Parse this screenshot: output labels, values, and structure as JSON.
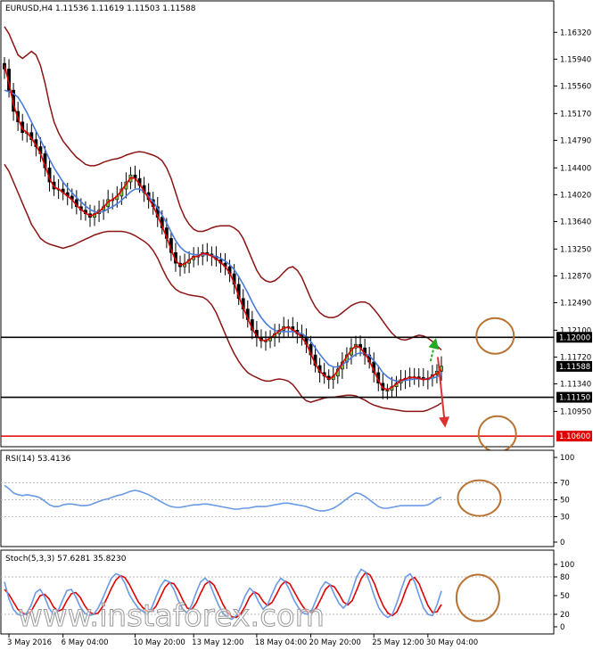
{
  "chart_data": {
    "type": "line",
    "symbol_header": "EURUSD,H4  1.11536 1.11619 1.11503 1.11588",
    "price_axis": {
      "ylim": [
        1.1045,
        1.165
      ],
      "ticks": [
        "1.16320",
        "1.15940",
        "1.15560",
        "1.15170",
        "1.14790",
        "1.14400",
        "1.14020",
        "1.13640",
        "1.13250",
        "1.12870",
        "1.12490",
        "1.12100",
        "1.11720",
        "1.11340",
        "1.10950"
      ]
    },
    "x_labels": [
      {
        "i": 1,
        "label": "3 May 2016"
      },
      {
        "i": 13,
        "label": "6 May 04:00"
      },
      {
        "i": 29,
        "label": "10 May 20:00"
      },
      {
        "i": 42,
        "label": "13 May 12:00"
      },
      {
        "i": 56,
        "label": "18 May 04:00"
      },
      {
        "i": 68,
        "label": "20 May 20:00"
      },
      {
        "i": 82,
        "label": "25 May 12:00"
      },
      {
        "i": 94,
        "label": "30 May 04:00"
      }
    ],
    "series": [
      {
        "kind": "close",
        "color": "#1a1a1a",
        "values": [
          1.158,
          1.155,
          1.152,
          1.1505,
          1.149,
          1.149,
          1.148,
          1.147,
          1.146,
          1.144,
          1.142,
          1.141,
          1.141,
          1.1405,
          1.14,
          1.1395,
          1.1385,
          1.138,
          1.1375,
          1.137,
          1.1375,
          1.138,
          1.1385,
          1.1395,
          1.1395,
          1.14,
          1.141,
          1.142,
          1.143,
          1.1425,
          1.1415,
          1.1405,
          1.1395,
          1.1385,
          1.137,
          1.1355,
          1.134,
          1.132,
          1.1305,
          1.13,
          1.1305,
          1.131,
          1.1315,
          1.1315,
          1.132,
          1.1318,
          1.1315,
          1.131,
          1.1305,
          1.13,
          1.129,
          1.1275,
          1.1255,
          1.124,
          1.1225,
          1.121,
          1.12,
          1.1195,
          1.1195,
          1.12,
          1.1205,
          1.121,
          1.1215,
          1.1215,
          1.121,
          1.1205,
          1.12,
          1.119,
          1.1175,
          1.116,
          1.115,
          1.1145,
          1.114,
          1.1145,
          1.1155,
          1.1165,
          1.1175,
          1.1185,
          1.119,
          1.1185,
          1.1175,
          1.1165,
          1.115,
          1.1135,
          1.1125,
          1.1125,
          1.113,
          1.1135,
          1.114,
          1.1142,
          1.1144,
          1.1144,
          1.1143,
          1.114,
          1.1142,
          1.1147,
          1.1152,
          1.1159
        ]
      },
      {
        "kind": "ma_fast",
        "color": "#e00000",
        "values": [
          1.1585,
          1.156,
          1.153,
          1.151,
          1.1495,
          1.149,
          1.1482,
          1.1472,
          1.146,
          1.1443,
          1.1425,
          1.1413,
          1.141,
          1.1405,
          1.14,
          1.1395,
          1.1387,
          1.1381,
          1.1376,
          1.1372,
          1.1374,
          1.1378,
          1.1384,
          1.1392,
          1.1395,
          1.14,
          1.1408,
          1.1417,
          1.1426,
          1.1425,
          1.1417,
          1.1407,
          1.1397,
          1.1386,
          1.1372,
          1.1357,
          1.1342,
          1.1324,
          1.1309,
          1.1302,
          1.1304,
          1.1309,
          1.1314,
          1.1315,
          1.1319,
          1.1318,
          1.1315,
          1.1311,
          1.1306,
          1.13,
          1.1291,
          1.1277,
          1.1258,
          1.1242,
          1.1227,
          1.1212,
          1.1202,
          1.1196,
          1.1195,
          1.1199,
          1.1204,
          1.1209,
          1.1213,
          1.1214,
          1.1211,
          1.1206,
          1.12,
          1.1191,
          1.1177,
          1.1162,
          1.1152,
          1.1146,
          1.1141,
          1.1144,
          1.1153,
          1.1163,
          1.1173,
          1.1182,
          1.1188,
          1.1185,
          1.1177,
          1.1167,
          1.1153,
          1.1139,
          1.1128,
          1.1126,
          1.1129,
          1.1134,
          1.1139,
          1.1141,
          1.1143,
          1.1143,
          1.1142,
          1.114,
          1.1141,
          1.1145,
          1.1149,
          1.1154
        ]
      },
      {
        "kind": "ma_slow",
        "color": "#4a7bdb",
        "values": [
          1.155,
          1.1548,
          1.1545,
          1.154,
          1.153,
          1.1518,
          1.1505,
          1.1492,
          1.148,
          1.1466,
          1.1452,
          1.144,
          1.143,
          1.142,
          1.1412,
          1.1405,
          1.1398,
          1.1392,
          1.1386,
          1.1381,
          1.1378,
          1.1377,
          1.1378,
          1.1382,
          1.1385,
          1.1389,
          1.1394,
          1.14,
          1.1406,
          1.141,
          1.141,
          1.1406,
          1.14,
          1.1392,
          1.1383,
          1.1373,
          1.1362,
          1.1349,
          1.1337,
          1.1328,
          1.1322,
          1.1319,
          1.1317,
          1.1317,
          1.1317,
          1.1317,
          1.1316,
          1.1314,
          1.1312,
          1.1308,
          1.1303,
          1.1296,
          1.1286,
          1.1275,
          1.1263,
          1.125,
          1.1238,
          1.1228,
          1.122,
          1.1214,
          1.121,
          1.1208,
          1.1208,
          1.1208,
          1.1208,
          1.1207,
          1.1205,
          1.1201,
          1.1194,
          1.1185,
          1.1176,
          1.1168,
          1.1161,
          1.1158,
          1.1158,
          1.1161,
          1.1166,
          1.1171,
          1.1176,
          1.1178,
          1.1177,
          1.1174,
          1.1167,
          1.1159,
          1.115,
          1.1144,
          1.114,
          1.1138,
          1.1138,
          1.1139,
          1.114,
          1.1141,
          1.1141,
          1.1141,
          1.1141,
          1.1142,
          1.1144,
          1.1147
        ]
      },
      {
        "kind": "bollinger_upper",
        "color": "#8b1414",
        "values": [
          1.164,
          1.163,
          1.1615,
          1.16,
          1.1595,
          1.16,
          1.1605,
          1.16,
          1.1585,
          1.156,
          1.153,
          1.1505,
          1.149,
          1.1478,
          1.147,
          1.1462,
          1.1455,
          1.145,
          1.1445,
          1.1443,
          1.1443,
          1.1445,
          1.1448,
          1.145,
          1.1452,
          1.1453,
          1.1455,
          1.1458,
          1.146,
          1.1462,
          1.1463,
          1.1462,
          1.146,
          1.1458,
          1.1455,
          1.145,
          1.144,
          1.1425,
          1.1405,
          1.1385,
          1.137,
          1.136,
          1.1353,
          1.135,
          1.135,
          1.1352,
          1.1355,
          1.1357,
          1.1358,
          1.1358,
          1.1358,
          1.1355,
          1.135,
          1.134,
          1.1325,
          1.131,
          1.1295,
          1.1285,
          1.128,
          1.1278,
          1.128,
          1.1285,
          1.1292,
          1.1298,
          1.13,
          1.1295,
          1.1285,
          1.127,
          1.1255,
          1.1243,
          1.1235,
          1.123,
          1.1228,
          1.1228,
          1.123,
          1.1235,
          1.124,
          1.1245,
          1.1248,
          1.125,
          1.125,
          1.1247,
          1.124,
          1.1232,
          1.1223,
          1.1214,
          1.1206,
          1.12,
          1.1197,
          1.1196,
          1.1198,
          1.1201,
          1.1203,
          1.1202,
          1.1199,
          1.1194,
          1.1188,
          1.1182
        ]
      },
      {
        "kind": "bollinger_lower",
        "color": "#8b1414",
        "values": [
          1.1445,
          1.1435,
          1.142,
          1.1405,
          1.139,
          1.1375,
          1.136,
          1.135,
          1.134,
          1.1335,
          1.1332,
          1.133,
          1.1328,
          1.1326,
          1.1328,
          1.133,
          1.1333,
          1.1336,
          1.1339,
          1.1342,
          1.1345,
          1.1347,
          1.1349,
          1.135,
          1.135,
          1.135,
          1.135,
          1.1349,
          1.1347,
          1.1344,
          1.134,
          1.1336,
          1.1331,
          1.1323,
          1.1312,
          1.1298,
          1.1285,
          1.1275,
          1.1268,
          1.1264,
          1.1262,
          1.126,
          1.1259,
          1.1258,
          1.1257,
          1.1253,
          1.1246,
          1.1235,
          1.122,
          1.1205,
          1.119,
          1.1177,
          1.1166,
          1.1157,
          1.115,
          1.1146,
          1.1143,
          1.114,
          1.1138,
          1.1138,
          1.114,
          1.1141,
          1.114,
          1.1138,
          1.1133,
          1.1125,
          1.1116,
          1.111,
          1.1108,
          1.111,
          1.1112,
          1.1114,
          1.1115,
          1.1115,
          1.1116,
          1.1117,
          1.1118,
          1.1118,
          1.1117,
          1.1114,
          1.1111,
          1.1107,
          1.1104,
          1.1102,
          1.11,
          1.1099,
          1.1098,
          1.1097,
          1.1096,
          1.1095,
          1.1095,
          1.1095,
          1.1095,
          1.1095,
          1.1097,
          1.11,
          1.1103,
          1.1107
        ]
      }
    ],
    "levels": [
      {
        "value": 1.12,
        "label": "1.12000",
        "color": "#000000",
        "tag_color": "#000000"
      },
      {
        "value": 1.1115,
        "label": "1.11150",
        "color": "#000000",
        "tag_color": "#000000"
      },
      {
        "value": 1.106,
        "label": "1.10600",
        "color": "#e00000",
        "tag_color": "#e00000"
      }
    ],
    "current_price": {
      "value": 1.11588,
      "label": "1.11588",
      "tag_color": "#000000"
    },
    "annotations": [
      {
        "kind": "circle",
        "panel": "price",
        "x": 1.123,
        "y": 1.1202,
        "color": "#b87333"
      },
      {
        "kind": "circle",
        "panel": "price",
        "x": 1.128,
        "y": 1.1063,
        "color": "#b87333"
      },
      {
        "kind": "arrow",
        "panel": "price",
        "from": [
          94.6,
          1.1166
        ],
        "to": [
          95.7,
          1.1196
        ],
        "color": "#22aa22",
        "style": "dashed"
      },
      {
        "kind": "arrow",
        "panel": "price",
        "from": [
          96.2,
          1.1172
        ],
        "to": [
          97.8,
          1.1075
        ],
        "color": "#e03030",
        "style": "solid"
      }
    ],
    "rsi": {
      "title": "RSI(14) 53.4136",
      "ylim": [
        0,
        100
      ],
      "ticks": [
        "100",
        "70",
        "50",
        "30",
        "0"
      ],
      "levels": [
        70,
        50,
        30
      ],
      "color": "#6a9ae6",
      "values": [
        67,
        63,
        58,
        56,
        55,
        56,
        55,
        54,
        52,
        48,
        44,
        42,
        42,
        44,
        45,
        45,
        44,
        43,
        43,
        44,
        46,
        48,
        50,
        51,
        53,
        55,
        56,
        58,
        60,
        61,
        60,
        58,
        56,
        53,
        50,
        47,
        44,
        42,
        41,
        41,
        42,
        43,
        44,
        44,
        45,
        45,
        44,
        43,
        42,
        41,
        40,
        39,
        39,
        40,
        40,
        41,
        42,
        42,
        42,
        43,
        44,
        45,
        46,
        46,
        45,
        44,
        43,
        42,
        40,
        38,
        37,
        37,
        38,
        40,
        43,
        47,
        51,
        55,
        58,
        57,
        54,
        50,
        46,
        42,
        40,
        40,
        41,
        42,
        43,
        43,
        43,
        43,
        43,
        43,
        44,
        47,
        51,
        53
      ],
      "circle": {
        "x": 1.105,
        "y": 52,
        "color": "#b87333"
      }
    },
    "stoch": {
      "title": "Stoch(5,3,3) 57.6281 35.8230",
      "ylim": [
        0,
        100
      ],
      "ticks": [
        "100",
        "80",
        "50",
        "20",
        "0"
      ],
      "levels": [
        80,
        20
      ],
      "main_color": "#6a9ae6",
      "signal_color": "#e00000",
      "main": [
        72,
        45,
        28,
        20,
        18,
        22,
        35,
        55,
        60,
        48,
        30,
        20,
        25,
        42,
        58,
        60,
        48,
        32,
        22,
        18,
        20,
        30,
        45,
        62,
        78,
        85,
        82,
        70,
        52,
        40,
        30,
        25,
        20,
        30,
        48,
        65,
        75,
        72,
        60,
        42,
        28,
        22,
        35,
        55,
        72,
        78,
        70,
        52,
        35,
        22,
        15,
        12,
        18,
        32,
        50,
        62,
        55,
        40,
        28,
        35,
        52,
        68,
        78,
        72,
        58,
        42,
        30,
        22,
        20,
        28,
        45,
        62,
        72,
        68,
        52,
        38,
        30,
        38,
        58,
        80,
        92,
        88,
        70,
        48,
        30,
        20,
        15,
        20,
        38,
        60,
        80,
        85,
        72,
        50,
        30,
        20,
        18,
        35,
        57.6
      ],
      "signal": [
        60,
        52,
        40,
        28,
        22,
        20,
        25,
        38,
        50,
        52,
        45,
        32,
        25,
        28,
        42,
        53,
        55,
        47,
        34,
        24,
        20,
        22,
        32,
        46,
        62,
        75,
        82,
        79,
        68,
        54,
        40,
        31,
        25,
        25,
        33,
        48,
        63,
        71,
        69,
        58,
        43,
        30,
        28,
        38,
        54,
        68,
        73,
        67,
        52,
        36,
        24,
        16,
        15,
        21,
        33,
        48,
        56,
        52,
        41,
        34,
        39,
        52,
        66,
        73,
        69,
        56,
        43,
        32,
        24,
        23,
        31,
        45,
        60,
        67,
        64,
        53,
        40,
        35,
        42,
        59,
        77,
        87,
        83,
        69,
        49,
        33,
        22,
        18,
        24,
        39,
        59,
        75,
        79,
        69,
        51,
        34,
        23,
        24,
        35.8
      ],
      "circle": {
        "x": 1.11,
        "y": 35,
        "color": "#b87333"
      }
    },
    "grid": false
  },
  "watermark": "www.instaforex.com"
}
